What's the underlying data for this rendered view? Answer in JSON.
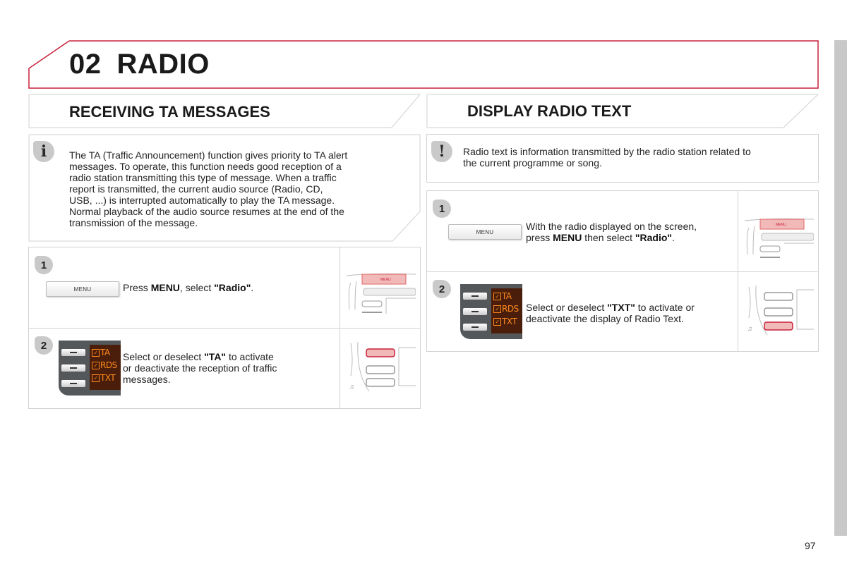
{
  "chapter": {
    "number": "02",
    "title": "RADIO"
  },
  "page_number": "97",
  "colors": {
    "accent": "#c8203a",
    "border": "#d2d2d2",
    "badge": "#c9c9c9",
    "lcd_text": "#ff8a1e",
    "highlight": "#f2b9b9"
  },
  "left_section": {
    "heading": "RECEIVING TA MESSAGES",
    "note": {
      "icon": "info-icon",
      "icon_glyph": "i",
      "lines": [
        "The TA (Traffic Announcement) function gives priority to TA alert",
        "messages. To operate, this function needs good reception of a",
        "radio station transmitting this type of message. When a traffic",
        "report is transmitted, the current audio source (Radio, CD,",
        "USB, ...) is interrupted automatically to play the TA message.",
        "Normal playback of the audio source resumes at the end of the",
        "transmission of the message."
      ]
    },
    "steps": [
      {
        "number": "1",
        "button_label": "MENU",
        "text_parts": [
          "Press ",
          "MENU",
          ", select ",
          "\"Radio\"",
          "."
        ]
      },
      {
        "number": "2",
        "screen_options": [
          "TA",
          "RDS",
          "TXT"
        ],
        "text_parts": [
          "Select or deselect ",
          "\"TA\"",
          " to activate",
          "or deactivate the reception of traffic",
          "messages."
        ]
      }
    ],
    "diagram_menu_label": "MENU"
  },
  "right_section": {
    "heading": "DISPLAY RADIO TEXT",
    "note": {
      "icon": "warning-icon",
      "icon_glyph": "!",
      "lines": [
        "Radio text is information transmitted by the radio station related to",
        "the current programme or song."
      ]
    },
    "steps": [
      {
        "number": "1",
        "button_label": "MENU",
        "text_parts": [
          "With the radio displayed on the screen,",
          "press ",
          "MENU",
          " then select ",
          "\"Radio\"",
          "."
        ]
      },
      {
        "number": "2",
        "screen_options": [
          "TA",
          "RDS",
          "TXT"
        ],
        "text_parts": [
          "Select or deselect ",
          "\"TXT\"",
          " to activate or",
          "deactivate the display of Radio Text."
        ]
      }
    ],
    "diagram_menu_label": "MENU"
  }
}
